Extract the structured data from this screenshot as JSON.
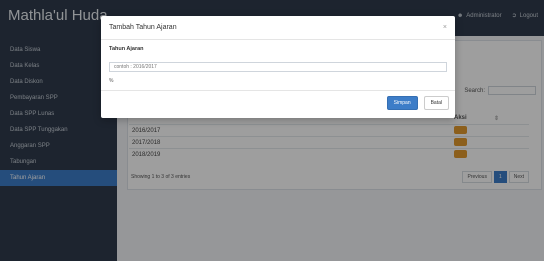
{
  "brand": "Mathla'ul Huda",
  "topbar": {
    "user_label": "Administrator",
    "logout_label": "Logout"
  },
  "sidebar": {
    "items": [
      {
        "label": "Data Siswa"
      },
      {
        "label": "Data Kelas"
      },
      {
        "label": "Data Diskon"
      },
      {
        "label": "Pembayaran SPP"
      },
      {
        "label": "Data SPP Lunas"
      },
      {
        "label": "Data SPP Tunggakan"
      },
      {
        "label": "Anggaran SPP"
      },
      {
        "label": "Tabungan"
      },
      {
        "label": "Tahun Ajaran"
      }
    ]
  },
  "table": {
    "search_label": "Search:",
    "col_aksi": "Aksi",
    "rows": [
      {
        "year": "2016/2017"
      },
      {
        "year": "2017/2018"
      },
      {
        "year": "2018/2019"
      }
    ],
    "info": "Showing 1 to 3 of 3 entries",
    "prev_label": "Previous",
    "page": "1",
    "next_label": "Next"
  },
  "modal": {
    "title": "Tambah Tahun Ajaran",
    "close": "×",
    "field_label": "Tahun Ajaran",
    "field_placeholder": "contoh : 2016/2017",
    "percent_hint": "%",
    "save_label": "Simpan",
    "cancel_label": "Batal"
  },
  "colors": {
    "primary": "#3d7dc8",
    "sidebar": "#2f3b4c",
    "edit_button": "#e29a2e"
  }
}
